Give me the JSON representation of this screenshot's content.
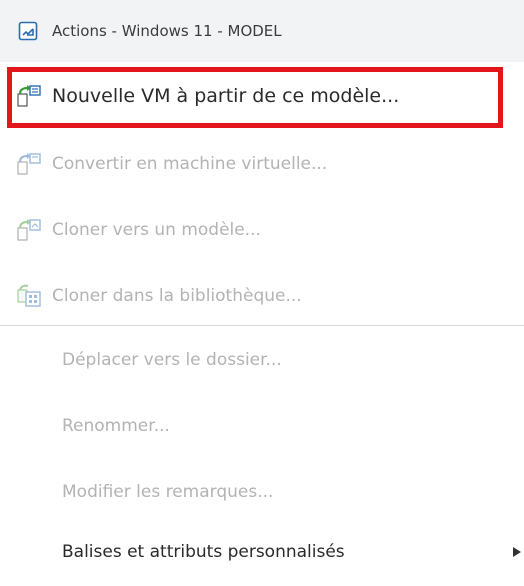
{
  "header": {
    "title": "Actions - Windows 11 - MODEL",
    "icon": "vm-template-icon"
  },
  "items": [
    {
      "label": "Nouvelle VM à partir de ce modèle...",
      "icon": "new-vm-from-template-icon",
      "enabled": true,
      "highlighted": true
    },
    {
      "label": "Convertir en machine virtuelle...",
      "icon": "convert-to-vm-icon",
      "enabled": false
    },
    {
      "label": "Cloner vers un modèle...",
      "icon": "clone-to-template-icon",
      "enabled": false
    },
    {
      "label": "Cloner dans la bibliothèque...",
      "icon": "clone-to-library-icon",
      "enabled": false
    },
    {
      "label": "Déplacer vers le dossier...",
      "enabled": false
    },
    {
      "label": "Renommer...",
      "enabled": false
    },
    {
      "label": "Modifier les remarques...",
      "enabled": false
    },
    {
      "label": "Balises et attributs personnalisés",
      "enabled": true,
      "submenu": true,
      "submenu_icon": "caret-right-icon"
    }
  ],
  "colors": {
    "highlight_border": "#e3161c",
    "header_bg": "#f1f3f5",
    "icon_green": "#3a9a2f",
    "icon_blue": "#2b6cb0"
  }
}
